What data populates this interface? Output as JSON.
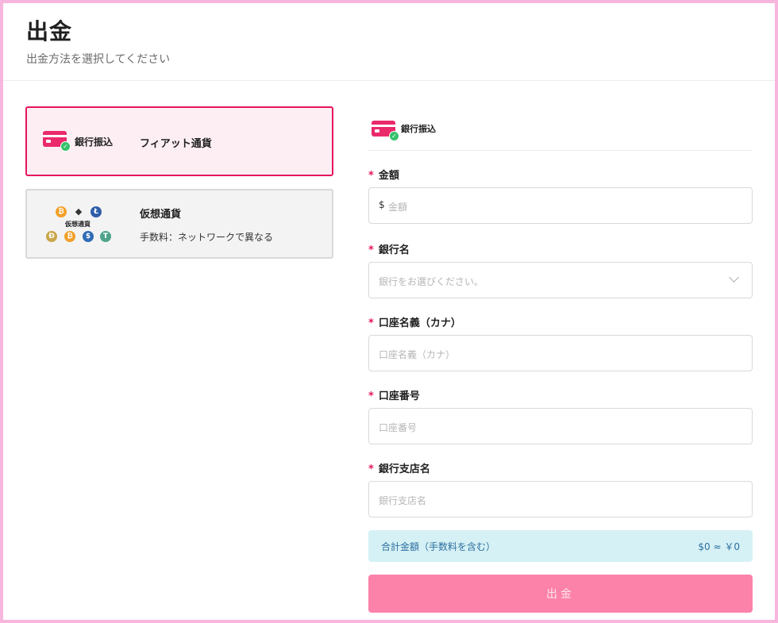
{
  "header": {
    "title": "出金",
    "subtitle": "出金方法を選択してください"
  },
  "methods": {
    "fiat": {
      "icon_label": "銀行振込",
      "label": "フィアット通貨"
    },
    "crypto": {
      "mini_label": "仮想通貨",
      "label": "仮想通貨",
      "fee": "手数料：ネットワークで異なる"
    }
  },
  "form": {
    "method_label": "銀行振込",
    "amount": {
      "label": "金額",
      "prefix": "$",
      "placeholder": "金額"
    },
    "bank": {
      "label": "銀行名",
      "placeholder": "銀行をお選びください。"
    },
    "holder": {
      "label": "口座名義（カナ）",
      "placeholder": "口座名義（カナ）"
    },
    "account": {
      "label": "口座番号",
      "placeholder": "口座番号"
    },
    "branch": {
      "label": "銀行支店名",
      "placeholder": "銀行支店名"
    },
    "required_mark": "*",
    "total_label": "合計金額（手数料を含む）",
    "total_value": "$0 ≈ ￥0",
    "submit_label": "出金"
  },
  "colors": {
    "accent": "#e4155f",
    "frame": "#f7b6dd",
    "submit": "#fc82aa",
    "total_bg": "#d5f1f5"
  },
  "coins": {
    "btc": "₿",
    "eth": "◆",
    "ltc": "Ł",
    "doge": "Ð",
    "bch": "₿",
    "usdc": "$",
    "usdt": "T"
  }
}
